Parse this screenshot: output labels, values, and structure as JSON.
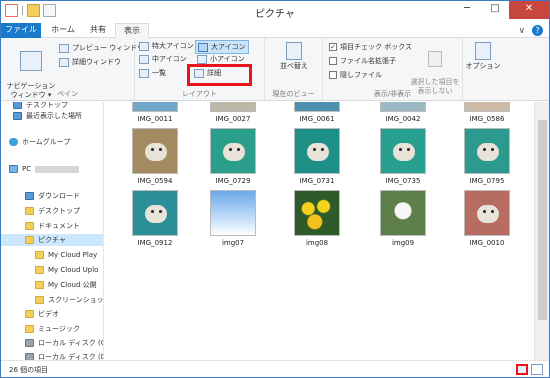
{
  "window": {
    "title": "ピクチャ",
    "minimize": "─",
    "maximize": "□",
    "close": "✕"
  },
  "quick_access": {
    "separator": "|"
  },
  "tabs": [
    {
      "label": "ファイル"
    },
    {
      "label": "ホーム"
    },
    {
      "label": "共有"
    },
    {
      "label": "表示"
    }
  ],
  "tab_extras": {
    "expand": "∨",
    "help": "?"
  },
  "ribbon": {
    "pane": {
      "label": "ペイン",
      "navigation_pane": "ナビゲーション\nウィンドウ ▾",
      "preview_window": "プレビュー ウィンドウ",
      "details_window": "詳細ウィンドウ"
    },
    "layout": {
      "label": "レイアウト",
      "extra_large_icons": "特大アイコン",
      "large_icons": "大アイコン",
      "medium_icons": "中アイコン",
      "small_icons": "小アイコン",
      "list": "一覧",
      "details": "詳細"
    },
    "current_view": {
      "label": "現在のビュー",
      "sort_by": "並べ替え"
    },
    "show_hide": {
      "label": "表示/非表示",
      "item_check_boxes": "項目チェック ボックス",
      "file_name_extensions": "ファイル名拡張子",
      "hidden_items": "隠しファイル",
      "hide_selected_items": "選択した項目を\n表示しない",
      "check_mark": "✓"
    },
    "options": "オプション"
  },
  "nav": {
    "items": [
      {
        "label": "デスクトップ"
      },
      {
        "label": "最近表示した場所"
      },
      {
        "label": "ホームグループ"
      },
      {
        "label": "PC"
      },
      {
        "label": "ダウンロード"
      },
      {
        "label": "デスクトップ"
      },
      {
        "label": "ドキュメント"
      },
      {
        "label": "ピクチャ"
      },
      {
        "label": "My Cloud Play"
      },
      {
        "label": "My Cloud Uplo"
      },
      {
        "label": "My Cloud 公開"
      },
      {
        "label": "スクリーンショット"
      },
      {
        "label": "ビデオ"
      },
      {
        "label": "ミュージック"
      },
      {
        "label": "ローカル ディスク (C"
      },
      {
        "label": "ローカル ディスク (D"
      }
    ]
  },
  "files": [
    {
      "name": "IMG_0011"
    },
    {
      "name": "IMG_0027"
    },
    {
      "name": "IMG_0061"
    },
    {
      "name": "IMG_0042"
    },
    {
      "name": "IMG_0586"
    },
    {
      "name": "IMG_0594"
    },
    {
      "name": "IMG_0729"
    },
    {
      "name": "IMG_0731"
    },
    {
      "name": "IMG_0735"
    },
    {
      "name": "IMG_0795"
    },
    {
      "name": "IMG_0912"
    },
    {
      "name": "img07"
    },
    {
      "name": "img08"
    },
    {
      "name": "img09"
    },
    {
      "name": "IMG_0010"
    }
  ],
  "status": {
    "item_count": "26 個の項目"
  },
  "colors": {
    "accent": "#1979ca",
    "highlight_box": "#e8141c",
    "selection": "#cce8ff"
  }
}
